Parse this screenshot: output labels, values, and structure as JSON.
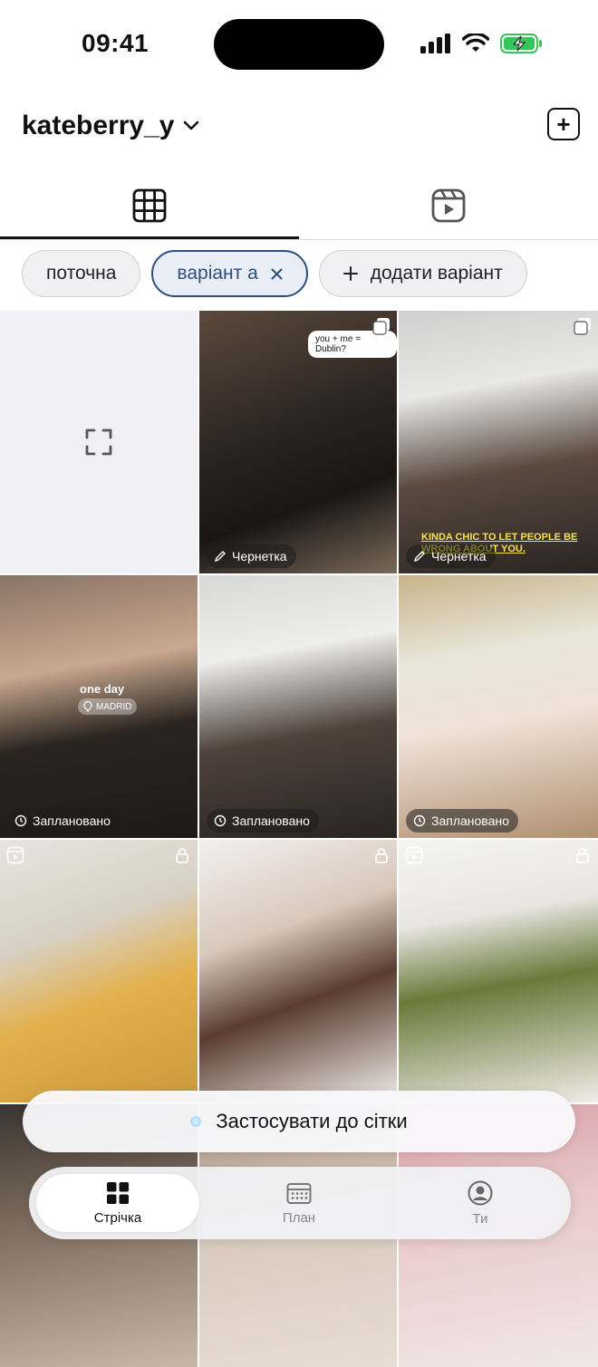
{
  "status_bar": {
    "time": "09:41"
  },
  "header": {
    "username": "kateberry_y"
  },
  "chips": [
    {
      "label": "поточна"
    },
    {
      "label": "варіант а"
    },
    {
      "label": "додати варіант"
    }
  ],
  "grid": {
    "cells": [
      {
        "type": "placeholder"
      },
      {
        "label": "Чернетка",
        "caption": "you + me = Dublin?",
        "gradient": "linear-gradient(160deg,#5b4a3d 0%,#2b2420 45%,#1a1614 70%,#7a6a5a 100%)"
      },
      {
        "label": "Чернетка",
        "overlay": "KINDA CHIC TO LET PEOPLE BE WRONG ABOUT YOU.",
        "gradient": "linear-gradient(170deg,#cfcfcf 0%,#e8e8e6 30%,#5a4a40 60%,#2a2422 100%)"
      },
      {
        "label": "Заплановано",
        "one_day": "one day",
        "location": "MADRID",
        "gradient": "linear-gradient(170deg,#8a7466 0%,#c9a890 35%,#2b2520 60%,#1c1a18 100%)"
      },
      {
        "label": "Заплановано",
        "gradient": "linear-gradient(170deg,#d8d8d6 0%,#eeeeec 30%,#4e423a 60%,#2a2422 100%)"
      },
      {
        "label": "Заплановано",
        "gradient": "linear-gradient(170deg,#c8b48a 0%,#e8e4d8 30%,#f0e2d8 55%,#b09070 100%)"
      },
      {
        "gradient": "linear-gradient(160deg,#e8e4de 0%,#d8d0c4 35%,#e3b04a 60%,#c89a3c 100%)"
      },
      {
        "gradient": "linear-gradient(160deg,#f4f0ee 0%,#d8c8bc 35%,#5a3c30 60%,#f2efeb 100%)"
      },
      {
        "gradient": "linear-gradient(170deg,#f4f4f2 0%,#e8e6e2 30%,#6a7a3a 55%,#f0ece8 100%)"
      },
      {
        "gradient": "linear-gradient(170deg,#3a3430 0%,#7a6a5c 40%,#c8b8aa 100%)"
      },
      {
        "gradient": "linear-gradient(170deg,#a89080 0%,#d8c8bc 40%,#e8dcd4 100%)"
      },
      {
        "gradient": "linear-gradient(170deg,#d8a0a8 0%,#e8c8c8 40%,#f0e8e4 100%)"
      }
    ]
  },
  "apply_button": {
    "label": "Застосувати до сітки"
  },
  "nav": {
    "feed": "Стрічка",
    "plan": "План",
    "you": "Ти"
  }
}
